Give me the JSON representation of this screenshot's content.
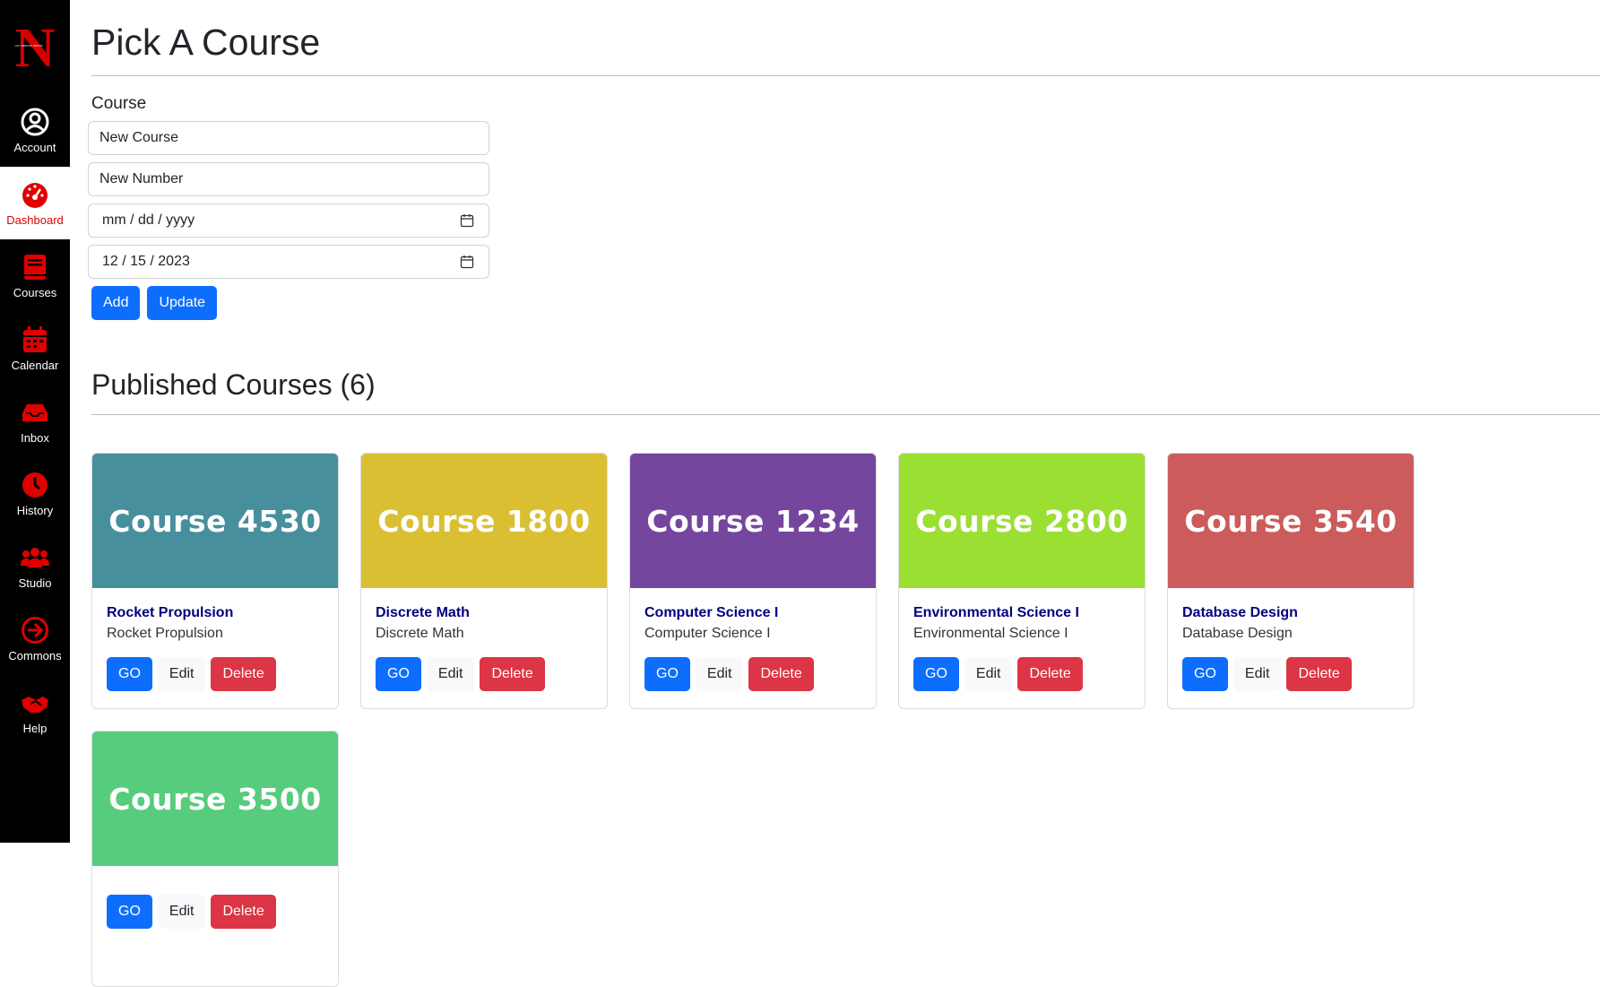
{
  "brand": {
    "logo_letter": "N",
    "logo_caption": "LUX VERITAS VIRTUS"
  },
  "nav": [
    {
      "label": "Account",
      "icon": "account-circle-icon"
    },
    {
      "label": "Dashboard",
      "icon": "dashboard-gauge-icon",
      "active": true
    },
    {
      "label": "Courses",
      "icon": "book-icon"
    },
    {
      "label": "Calendar",
      "icon": "calendar-icon"
    },
    {
      "label": "Inbox",
      "icon": "inbox-tray-icon"
    },
    {
      "label": "History",
      "icon": "clock-icon"
    },
    {
      "label": "Studio",
      "icon": "users-group-icon"
    },
    {
      "label": "Commons",
      "icon": "arrow-right-circle-icon"
    },
    {
      "label": "Help",
      "icon": "handshake-icon"
    }
  ],
  "page": {
    "title": "Pick A Course",
    "form_label": "Course",
    "course_name_value": "New Course",
    "course_number_value": "New Number",
    "start_date_value": "mm / dd / yyyy",
    "end_date_value": "12 / 15 / 2023",
    "add_label": "Add",
    "update_label": "Update",
    "published_title": "Published Courses (6)"
  },
  "courses": [
    {
      "header": "Course 4530",
      "title": "Rocket Propulsion",
      "subtitle": "Rocket Propulsion",
      "color": "#478f9d"
    },
    {
      "header": "Course 1800",
      "title": "Discrete Math",
      "subtitle": "Discrete Math",
      "color": "#dbbf33"
    },
    {
      "header": "Course 1234",
      "title": "Computer Science I",
      "subtitle": "Computer Science I",
      "color": "#74469e"
    },
    {
      "header": "Course 2800",
      "title": "Environmental Science I",
      "subtitle": "Environmental Science I",
      "color": "#9bdf33"
    },
    {
      "header": "Course 3540",
      "title": "Database Design",
      "subtitle": "Database Design",
      "color": "#cc5b5b"
    },
    {
      "header": "Course 3500",
      "title": "",
      "subtitle": "",
      "color": "#57cc7d"
    }
  ],
  "card_buttons": {
    "go": "GO",
    "edit": "Edit",
    "delete": "Delete"
  },
  "colors": {
    "primary": "#0d6efd",
    "danger": "#dc3545",
    "brand_red": "#e00000",
    "sidebar": "#000000"
  }
}
